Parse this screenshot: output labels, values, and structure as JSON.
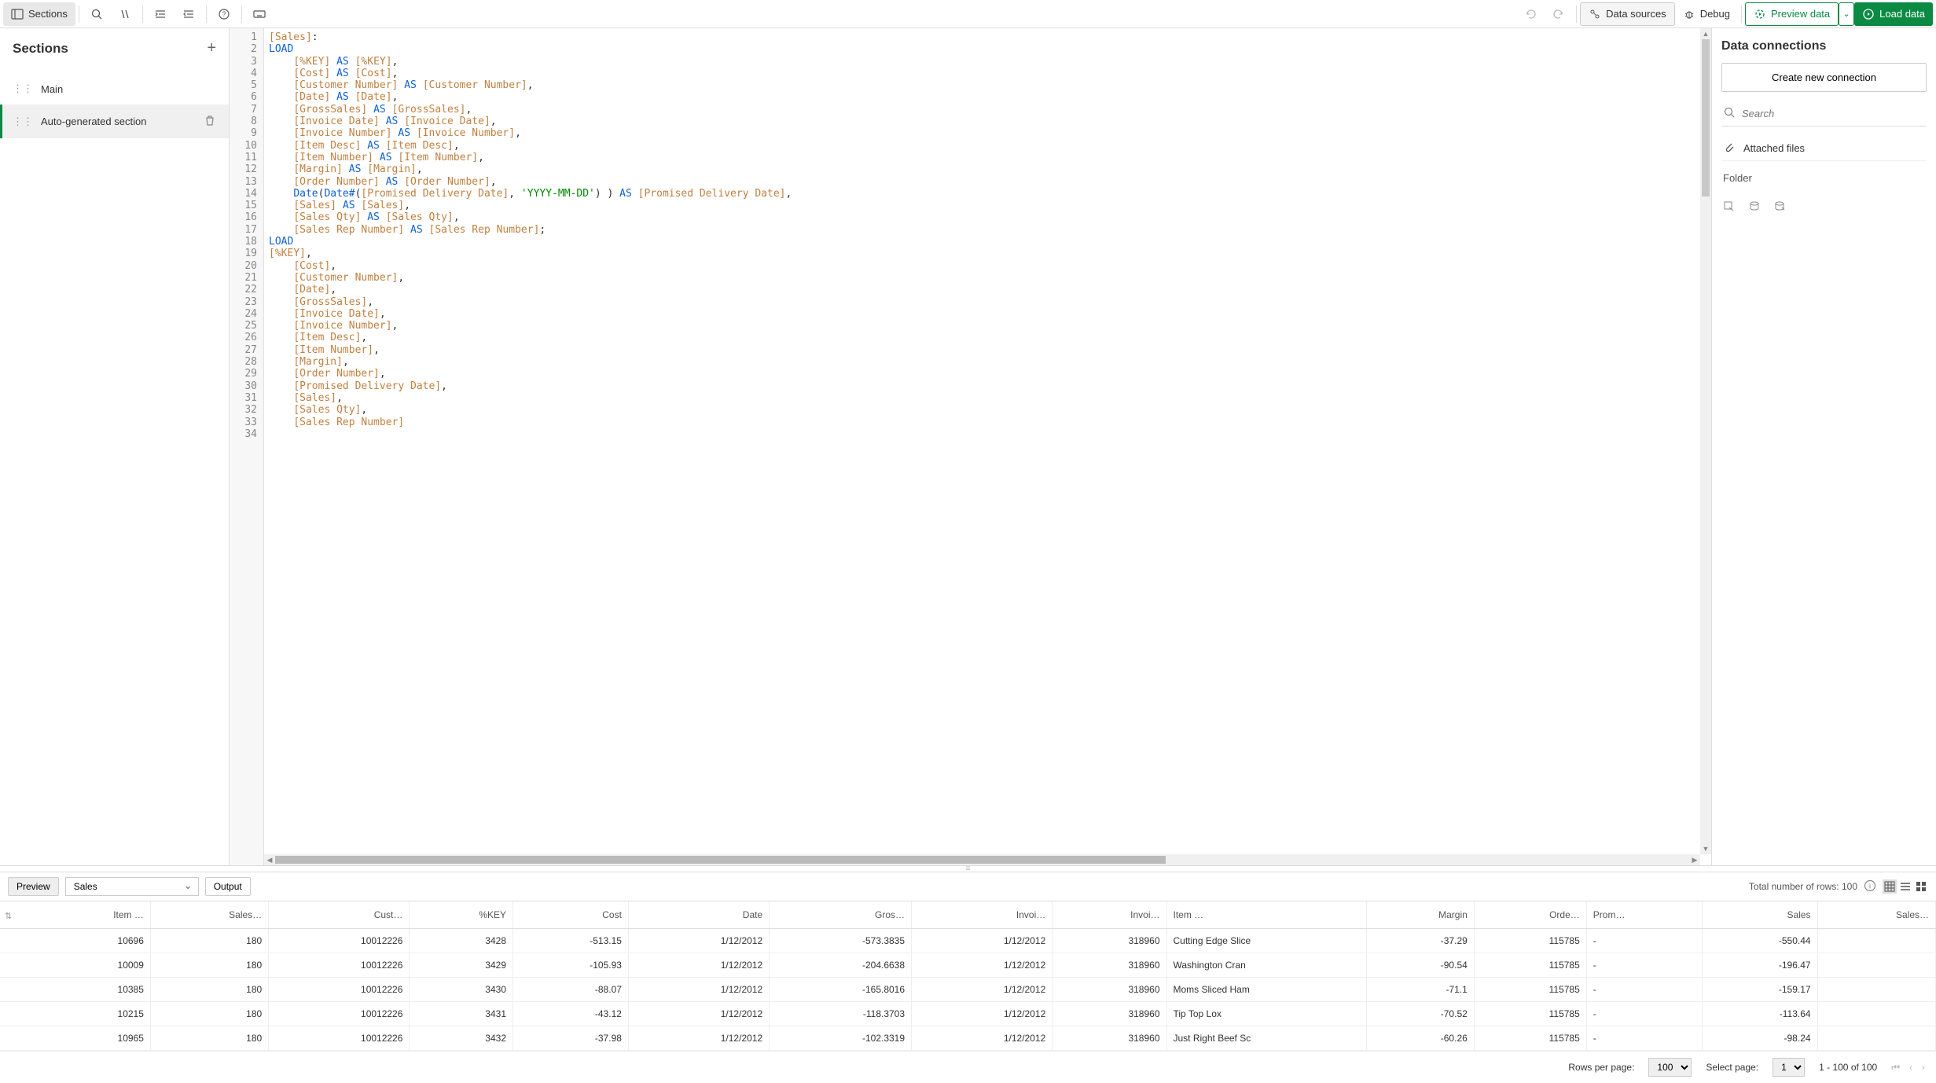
{
  "toolbar": {
    "sections_label": "Sections",
    "data_sources_label": "Data sources",
    "debug_label": "Debug",
    "preview_data_label": "Preview data",
    "load_data_label": "Load data"
  },
  "sidebar": {
    "title": "Sections",
    "items": [
      {
        "label": "Main"
      },
      {
        "label": "Auto-generated section"
      }
    ]
  },
  "code": {
    "lines": [
      {
        "n": 1,
        "html": "<span class='tok-bracket'>[Sales]</span>:"
      },
      {
        "n": 2,
        "html": "<span class='tok-kw'>LOAD</span>"
      },
      {
        "n": 3,
        "html": "    <span class='tok-bracket'>[%KEY]</span> <span class='tok-kw'>AS</span> <span class='tok-bracket'>[%KEY]</span>,"
      },
      {
        "n": 4,
        "html": "    <span class='tok-bracket'>[Cost]</span> <span class='tok-kw'>AS</span> <span class='tok-bracket'>[Cost]</span>,"
      },
      {
        "n": 5,
        "html": "    <span class='tok-bracket'>[Customer Number]</span> <span class='tok-kw'>AS</span> <span class='tok-bracket'>[Customer Number]</span>,"
      },
      {
        "n": 6,
        "html": "    <span class='tok-bracket'>[Date]</span> <span class='tok-kw'>AS</span> <span class='tok-bracket'>[Date]</span>,"
      },
      {
        "n": 7,
        "html": "    <span class='tok-bracket'>[GrossSales]</span> <span class='tok-kw'>AS</span> <span class='tok-bracket'>[GrossSales]</span>,"
      },
      {
        "n": 8,
        "html": "    <span class='tok-bracket'>[Invoice Date]</span> <span class='tok-kw'>AS</span> <span class='tok-bracket'>[Invoice Date]</span>,"
      },
      {
        "n": 9,
        "html": "    <span class='tok-bracket'>[Invoice Number]</span> <span class='tok-kw'>AS</span> <span class='tok-bracket'>[Invoice Number]</span>,"
      },
      {
        "n": 10,
        "html": "    <span class='tok-bracket'>[Item Desc]</span> <span class='tok-kw'>AS</span> <span class='tok-bracket'>[Item Desc]</span>,"
      },
      {
        "n": 11,
        "html": "    <span class='tok-bracket'>[Item Number]</span> <span class='tok-kw'>AS</span> <span class='tok-bracket'>[Item Number]</span>,"
      },
      {
        "n": 12,
        "html": "    <span class='tok-bracket'>[Margin]</span> <span class='tok-kw'>AS</span> <span class='tok-bracket'>[Margin]</span>,"
      },
      {
        "n": 13,
        "html": "    <span class='tok-bracket'>[Order Number]</span> <span class='tok-kw'>AS</span> <span class='tok-bracket'>[Order Number]</span>,"
      },
      {
        "n": 14,
        "html": "    <span class='tok-fn'>Date</span>(<span class='tok-fn'>Date#</span>(<span class='tok-bracket'>[Promised Delivery Date]</span>, <span class='tok-str'>'YYYY-MM-DD'</span>) ) <span class='tok-kw'>AS</span> <span class='tok-bracket'>[Promised Delivery Date]</span>,"
      },
      {
        "n": 15,
        "html": "    <span class='tok-bracket'>[Sales]</span> <span class='tok-kw'>AS</span> <span class='tok-bracket'>[Sales]</span>,"
      },
      {
        "n": 16,
        "html": "    <span class='tok-bracket'>[Sales Qty]</span> <span class='tok-kw'>AS</span> <span class='tok-bracket'>[Sales Qty]</span>,"
      },
      {
        "n": 17,
        "html": "    <span class='tok-bracket'>[Sales Rep Number]</span> <span class='tok-kw'>AS</span> <span class='tok-bracket'>[Sales Rep Number]</span>;"
      },
      {
        "n": 18,
        "html": "<span class='tok-kw'>LOAD</span>"
      },
      {
        "n": 19,
        "html": "<span class='tok-bracket'>[%KEY]</span>,"
      },
      {
        "n": 20,
        "html": "    <span class='tok-bracket'>[Cost]</span>,"
      },
      {
        "n": 21,
        "html": "    <span class='tok-bracket'>[Customer Number]</span>,"
      },
      {
        "n": 22,
        "html": "    <span class='tok-bracket'>[Date]</span>,"
      },
      {
        "n": 23,
        "html": "    <span class='tok-bracket'>[GrossSales]</span>,"
      },
      {
        "n": 24,
        "html": "    <span class='tok-bracket'>[Invoice Date]</span>,"
      },
      {
        "n": 25,
        "html": "    <span class='tok-bracket'>[Invoice Number]</span>,"
      },
      {
        "n": 26,
        "html": "    <span class='tok-bracket'>[Item Desc]</span>,"
      },
      {
        "n": 27,
        "html": "    <span class='tok-bracket'>[Item Number]</span>,"
      },
      {
        "n": 28,
        "html": "    <span class='tok-bracket'>[Margin]</span>,"
      },
      {
        "n": 29,
        "html": "    <span class='tok-bracket'>[Order Number]</span>,"
      },
      {
        "n": 30,
        "html": "    <span class='tok-bracket'>[Promised Delivery Date]</span>,"
      },
      {
        "n": 31,
        "html": "    <span class='tok-bracket'>[Sales]</span>,"
      },
      {
        "n": 32,
        "html": "    <span class='tok-bracket'>[Sales Qty]</span>,"
      },
      {
        "n": 33,
        "html": "    <span class='tok-bracket'>[Sales Rep Number]</span>"
      },
      {
        "n": 34,
        "html": ""
      }
    ]
  },
  "rpanel": {
    "title": "Data connections",
    "new_conn_label": "Create new connection",
    "search_placeholder": "Search",
    "attached_label": "Attached files",
    "folder_label": "Folder"
  },
  "bottom": {
    "preview_tab": "Preview",
    "output_tab": "Output",
    "table_select": "Sales",
    "total_rows_label": "Total number of rows: 100",
    "columns": [
      "Item …",
      "Sales…",
      "Cust…",
      "%KEY",
      "Cost",
      "Date",
      "Gros…",
      "Invoi…",
      "Invoi…",
      "Item …",
      "Margin",
      "Orde…",
      "Prom…",
      "Sales",
      "Sales…"
    ],
    "col_align": [
      "r",
      "r",
      "r",
      "r",
      "r",
      "r",
      "r",
      "r",
      "r",
      "l",
      "r",
      "r",
      "l",
      "r",
      "r"
    ],
    "rows": [
      [
        "10696",
        "180",
        "10012226",
        "3428",
        "-513.15",
        "1/12/2012",
        "-573.3835",
        "1/12/2012",
        "318960",
        "Cutting Edge Slice",
        "-37.29",
        "115785",
        "-",
        "-550.44",
        ""
      ],
      [
        "10009",
        "180",
        "10012226",
        "3429",
        "-105.93",
        "1/12/2012",
        "-204.6638",
        "1/12/2012",
        "318960",
        "Washington Cran",
        "-90.54",
        "115785",
        "-",
        "-196.47",
        ""
      ],
      [
        "10385",
        "180",
        "10012226",
        "3430",
        "-88.07",
        "1/12/2012",
        "-165.8016",
        "1/12/2012",
        "318960",
        "Moms Sliced Ham",
        "-71.1",
        "115785",
        "-",
        "-159.17",
        ""
      ],
      [
        "10215",
        "180",
        "10012226",
        "3431",
        "-43.12",
        "1/12/2012",
        "-118.3703",
        "1/12/2012",
        "318960",
        "Tip Top Lox",
        "-70.52",
        "115785",
        "-",
        "-113.64",
        ""
      ],
      [
        "10965",
        "180",
        "10012226",
        "3432",
        "-37.98",
        "1/12/2012",
        "-102.3319",
        "1/12/2012",
        "318960",
        "Just Right Beef Sc",
        "-60.26",
        "115785",
        "-",
        "-98.24",
        ""
      ]
    ]
  },
  "pager": {
    "rows_per_page_label": "Rows per page:",
    "rows_per_page_value": "100",
    "select_page_label": "Select page:",
    "select_page_value": "1",
    "range_label": "1 - 100 of 100"
  }
}
